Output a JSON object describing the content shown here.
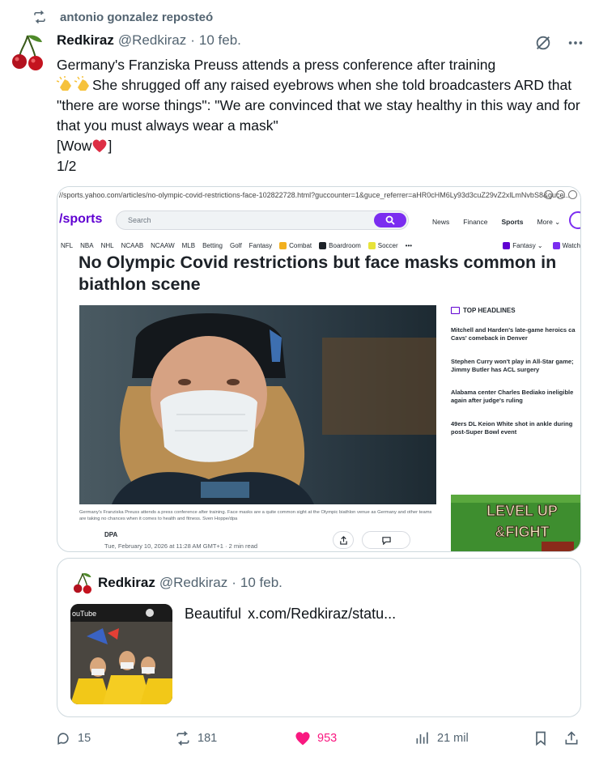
{
  "repost": {
    "label": "antonio gonzalez reposteó"
  },
  "tweet": {
    "author_name": "Redkiraz",
    "author_handle": "@Redkiraz",
    "separator": "·",
    "date": "10 feb.",
    "text_line1": "Germany's Franziska Preuss attends a press conference after training",
    "text_line2": "She shrugged off any raised eyebrows when she told broadcasters ARD that \"there are worse things\": \"We are convinced that we stay healthy in this way and for that you must always wear a mask\"",
    "text_wow_open": "[Wow",
    "text_wow_close": "]",
    "text_count": "1/2"
  },
  "screenshot": {
    "url": "//sports.yahoo.com/articles/no-olympic-covid-restrictions-face-102822728.html?guccounter=1&guce_referrer=aHR0cHM6Ly93d3cuZ29vZ2xlLmNvbS8&guce...",
    "logo": "/sports",
    "search_placeholder": "Search",
    "nav": [
      "News",
      "Finance",
      "Sports",
      "More ⌄"
    ],
    "subnav": [
      "NFL",
      "NBA",
      "NHL",
      "NCAAB",
      "NCAAW",
      "MLB",
      "Betting",
      "Golf",
      "Fantasy"
    ],
    "subnav_chips": [
      "Combat",
      "Boardroom",
      "Soccer",
      "•••"
    ],
    "subnav_right": [
      "Fantasy ⌄",
      "Watch"
    ],
    "article_title": "No Olympic Covid restrictions but face masks common in biathlon scene",
    "caption": "Germany's Franziska Preuss attends a press conference after training. Face masks are a quite common sight at the Olympic biathlon venue as Germany and other teams are taking no chances when it comes to health and fitness. Sven Hoppe/dpa",
    "byline": "DPA",
    "byline_date": "Tue, February 10, 2026 at 11:28 AM GMT+1 · 2 min read",
    "headlines_title": "TOP HEADLINES",
    "headlines": [
      "Mitchell and Harden's late-game heroics ca Cavs' comeback in Denver",
      "Stephen Curry won't play in All-Star game; Jimmy Butler has ACL surgery",
      "Alabama center Charles Bediako ineligible again after judge's ruling",
      "49ers DL Keion White shot in ankle during post-Super Bowl event"
    ],
    "ad_text_1": "LEVEL UP",
    "ad_text_2": "&FIGHT"
  },
  "quote": {
    "author_name": "Redkiraz",
    "author_handle": "@Redkiraz",
    "separator": "·",
    "date": "10 feb.",
    "text": "Beautiful",
    "link": "x.com/Redkiraz/statu...",
    "thumb_label": "ouTube"
  },
  "actions": {
    "replies": "15",
    "reposts": "181",
    "likes": "953",
    "views": "21 mil"
  },
  "colors": {
    "like": "#f91880",
    "muted": "#536471",
    "yahoo_purple": "#6001d2"
  }
}
